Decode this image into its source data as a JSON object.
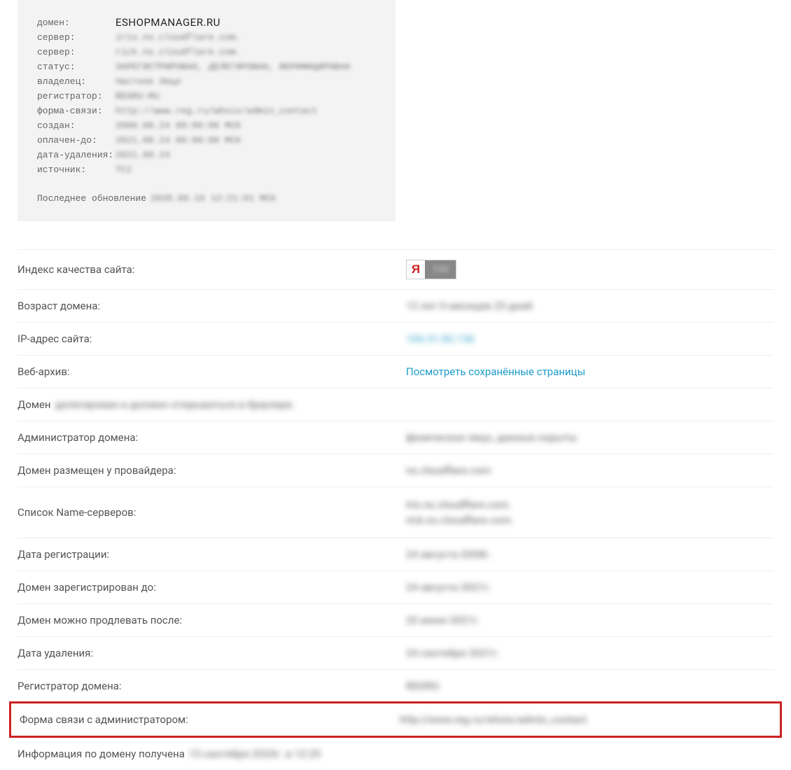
{
  "whois": {
    "rows": [
      {
        "label": "домен:",
        "value": "ESHOPMANAGER.RU",
        "sharp": true
      },
      {
        "label": "сервер:",
        "value": "iris.ns.cloudflare.com."
      },
      {
        "label": "сервер:",
        "value": "rick.ns.cloudflare.com."
      },
      {
        "label": "статус:",
        "value": "ЗАРЕГИСТРИРОВАН, ДЕЛЕГИРОВАН, ВЕРИФИЦИРОВАН"
      },
      {
        "label": "владелец:",
        "value": "Частное Лицо"
      },
      {
        "label": "регистратор:",
        "value": "REGRU-RU"
      },
      {
        "label": "форма-связи:",
        "value": "http://www.reg.ru/whois/admin_contact"
      },
      {
        "label": "создан:",
        "value": "2008.08.24 00:00:00 МСК"
      },
      {
        "label": "оплачен-до:",
        "value": "2021.08.24 00:00:00 МСК"
      },
      {
        "label": "дата-удаления:",
        "value": "2021.09.24"
      },
      {
        "label": "источник:",
        "value": "TCI"
      }
    ],
    "footer_label": "Последнее обновление",
    "footer_value": "2020.09.15 12:21:01 МСК"
  },
  "info": {
    "quality_label": "Индекс качества сайта:",
    "yandex_letter": "Я",
    "yandex_value": "100",
    "age_label": "Возраст домена:",
    "age_value": "12 лет 0 месяцев 25 дней",
    "ip_label": "IP-адрес сайта:",
    "ip_value": "104.31.82.136",
    "archive_label": "Веб-архив:",
    "archive_link": "Посмотреть сохранённые страницы",
    "domain_prefix": "Домен",
    "domain_status": "делегирован и должен открываться в браузере.",
    "admin_label": "Администратор домена:",
    "admin_value": "физическое лицо, данные скрыты",
    "provider_label": "Домен размещен у провайдера:",
    "provider_value": "ns.cloudflare.com",
    "ns_label": "Список Name-серверов:",
    "ns_value1": "iris.ns.cloudflare.com.",
    "ns_value2": "rick.ns.cloudflare.com.",
    "reg_date_label": "Дата регистрации:",
    "reg_date_value": "24 августа 2008г.",
    "reg_until_label": "Домен зарегистрирован до:",
    "reg_until_value": "24 августа 2021г.",
    "renew_after_label": "Домен можно продлевать после:",
    "renew_after_value": "25 июня 2021г.",
    "delete_date_label": "Дата удаления:",
    "delete_date_value": "24 сентября 2021г.",
    "registrar_label": "Регистратор домена:",
    "registrar_value": "REGRU",
    "contact_form_label": "Форма связи с администратором:",
    "contact_form_value": "http://www.reg.ru/whois/admin_contact",
    "received_prefix": "Информация по домену получена",
    "received_value": "15 сентября 2020г. в 12:25"
  }
}
